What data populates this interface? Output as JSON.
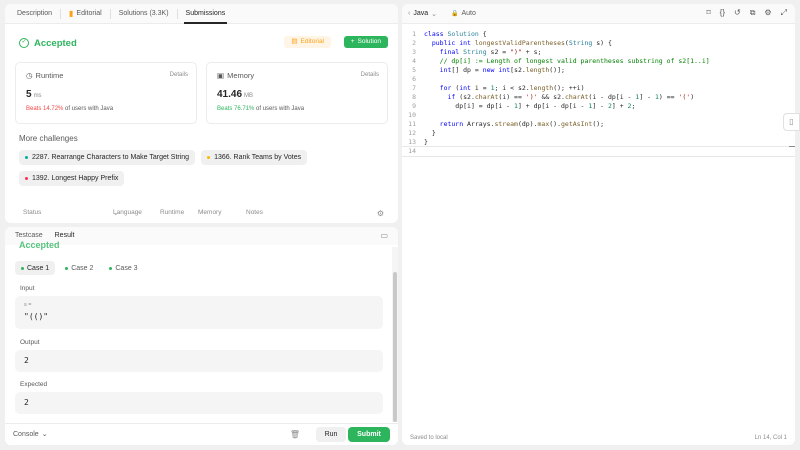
{
  "tabs": {
    "description": "Description",
    "editorial": "Editorial",
    "solutions": "Solutions (3.3K)",
    "submissions": "Submissions"
  },
  "result": {
    "status": "Accepted",
    "editorial_button": "Editorial",
    "solution_button": "Solution",
    "status_color": "#2db55d"
  },
  "runtime": {
    "label": "Runtime",
    "details": "Details",
    "value": "5",
    "unit": "ms",
    "beats": "Beats 14.72%",
    "beats_suffix": "of users with Java"
  },
  "memory": {
    "label": "Memory",
    "details": "Details",
    "value": "41.46",
    "unit": "MB",
    "beats": "Beats 76.71%",
    "beats_suffix": "of users with Java"
  },
  "more_challenges": {
    "title": "More challenges",
    "items": [
      {
        "label": "2287. Rearrange Characters to Make Target String",
        "color": "#00af9b"
      },
      {
        "label": "1366. Rank Teams by Votes",
        "color": "#ffb800"
      },
      {
        "label": "1392. Longest Happy Prefix",
        "color": "#ff2d55"
      }
    ]
  },
  "history_header": {
    "status": "Status",
    "language": "Language",
    "runtime": "Runtime",
    "memory": "Memory",
    "notes": "Notes"
  },
  "testcase": {
    "tab_testcase": "Testcase",
    "tab_result": "Result",
    "faded_status": "Accepted",
    "cases": [
      "Case 1",
      "Case 2",
      "Case 3"
    ],
    "input_label": "Input",
    "input_var": "s =",
    "input_value": "\"(()\"",
    "output_label": "Output",
    "output_value": "2",
    "expected_label": "Expected",
    "expected_value": "2",
    "console": "Console",
    "run": "Run",
    "submit": "Submit"
  },
  "editor": {
    "language": "Java",
    "mode": "Auto",
    "saved": "Saved to local",
    "position": "Ln 14, Col 1",
    "line_numbers": [
      "1",
      "2",
      "3",
      "4",
      "5",
      "6",
      "7",
      "8",
      "9",
      "10",
      "11",
      "12",
      "13",
      "14"
    ]
  }
}
